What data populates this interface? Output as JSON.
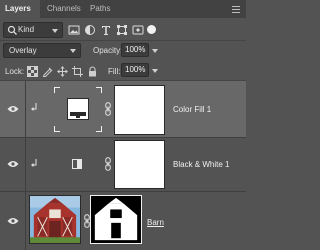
{
  "tabs": [
    {
      "label": "Layers",
      "active": true
    },
    {
      "label": "Channels",
      "active": false
    },
    {
      "label": "Paths",
      "active": false
    }
  ],
  "filter": {
    "kind_label": "Kind",
    "icons": [
      "image-filter-icon",
      "adjustment-filter-icon",
      "type-filter-icon",
      "shape-filter-icon",
      "smart-object-filter-icon"
    ]
  },
  "blend": {
    "mode": "Overlay",
    "opacity_label": "Opacity:",
    "opacity_value": "100%"
  },
  "lock": {
    "label": "Lock:",
    "fill_label": "Fill:",
    "fill_value": "100%"
  },
  "layers": [
    {
      "name": "Color Fill 1",
      "selected": true,
      "clipped": true,
      "type": "solid-color-fill"
    },
    {
      "name": "Black & White 1",
      "selected": false,
      "clipped": true,
      "type": "black-and-white-adjustment"
    },
    {
      "name": "Barn",
      "selected": false,
      "clipped": false,
      "type": "pixel"
    }
  ],
  "colors": {
    "panel_bg": "#535353",
    "tab_bar_bg": "#424242",
    "selected_row_bg": "#686868",
    "field_bg": "#3c3c3c",
    "barn_red": "#a8322c",
    "sky_blue": "#7fb3dd",
    "grass_green": "#5f8a3a"
  }
}
